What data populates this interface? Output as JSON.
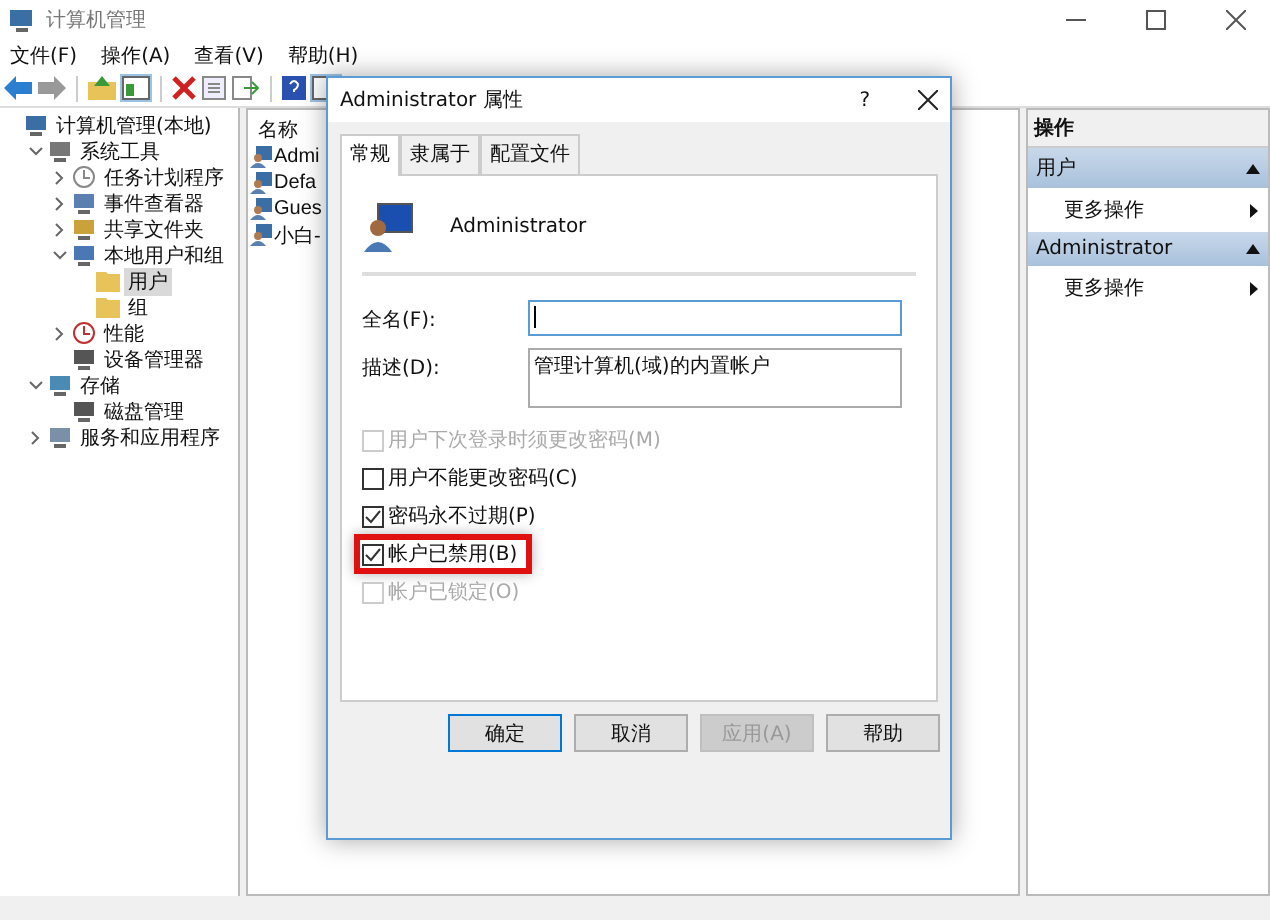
{
  "window": {
    "title": "计算机管理"
  },
  "menu": [
    "文件(F)",
    "操作(A)",
    "查看(V)",
    "帮助(H)"
  ],
  "tree": [
    {
      "label": "计算机管理(本地)",
      "kind": "computer",
      "selected": false,
      "children": [
        {
          "label": "系统工具",
          "kind": "tools",
          "selected": false,
          "expanded": true,
          "children": [
            {
              "label": "任务计划程序",
              "kind": "clock",
              "selected": false,
              "expanded": false
            },
            {
              "label": "事件查看器",
              "kind": "event",
              "selected": false,
              "expanded": false
            },
            {
              "label": "共享文件夹",
              "kind": "share",
              "selected": false,
              "expanded": false
            },
            {
              "label": "本地用户和组",
              "kind": "users",
              "selected": false,
              "expanded": true,
              "children": [
                {
                  "label": "用户",
                  "kind": "folder",
                  "selected": true
                },
                {
                  "label": "组",
                  "kind": "folder",
                  "selected": false
                }
              ]
            },
            {
              "label": "性能",
              "kind": "perf",
              "selected": false,
              "expanded": false
            },
            {
              "label": "设备管理器",
              "kind": "device",
              "selected": false
            }
          ]
        },
        {
          "label": "存储",
          "kind": "storage",
          "selected": false,
          "expanded": true,
          "children": [
            {
              "label": "磁盘管理",
              "kind": "disk",
              "selected": false
            }
          ]
        },
        {
          "label": "服务和应用程序",
          "kind": "services",
          "selected": false,
          "expanded": false
        }
      ]
    }
  ],
  "list": {
    "column_header": "名称",
    "rows": [
      "Admi",
      "Defa",
      "Gues",
      "小白-"
    ]
  },
  "actions": {
    "header": "操作",
    "sections": [
      {
        "title": "用户",
        "expanded": true,
        "items": [
          "更多操作"
        ]
      },
      {
        "title": "Administrator",
        "expanded": true,
        "items": [
          "更多操作"
        ]
      }
    ]
  },
  "dialog": {
    "title": "Administrator 属性",
    "help": "?",
    "tabs": [
      {
        "label": "常规",
        "selected": true
      },
      {
        "label": "隶属于",
        "selected": false
      },
      {
        "label": "配置文件",
        "selected": false
      }
    ],
    "user_name": "Administrator",
    "full_name": {
      "label": "全名(F):",
      "focused": true
    },
    "description": {
      "label": "描述(D):",
      "value": "管理计算机(域)的内置帐户"
    },
    "checkboxes": [
      {
        "label": "用户下次登录时须更改密码(M)",
        "checked": false,
        "disabled": true,
        "highlighted": false
      },
      {
        "label": "用户不能更改密码(C)",
        "checked": false,
        "disabled": false,
        "highlighted": false
      },
      {
        "label": "密码永不过期(P)",
        "checked": true,
        "disabled": false,
        "highlighted": false
      },
      {
        "label": "帐户已禁用(B)",
        "checked": true,
        "disabled": false,
        "highlighted": true
      },
      {
        "label": "帐户已锁定(O)",
        "checked": false,
        "disabled": true,
        "highlighted": false
      }
    ],
    "buttons": [
      {
        "label": "确定",
        "default": true,
        "disabled": false
      },
      {
        "label": "取消",
        "default": false,
        "disabled": false
      },
      {
        "label": "应用(A)",
        "default": false,
        "disabled": true
      },
      {
        "label": "帮助",
        "default": false,
        "disabled": false
      }
    ]
  }
}
